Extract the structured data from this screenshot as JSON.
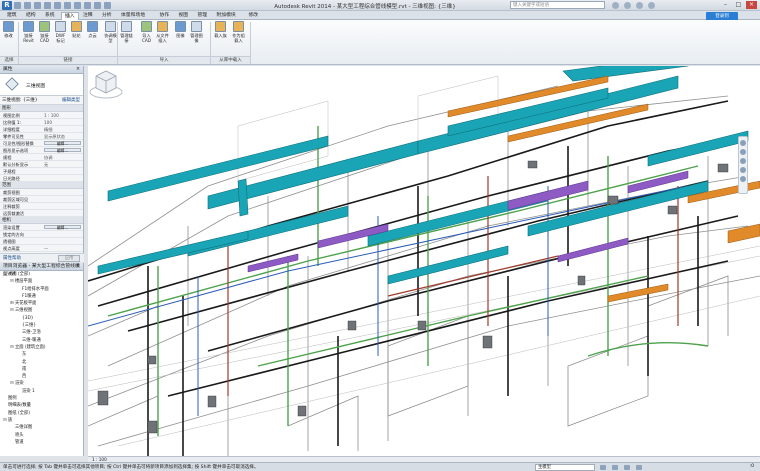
{
  "app": {
    "title": "Autodesk Revit 2014 -  某大型工程综合管线模型.rvt - 三维视图: {三维}",
    "search_placeholder": "键入关键字或短语",
    "signin_label": "登录到",
    "logo_letter": "R"
  },
  "tabs": [
    "建筑",
    "结构",
    "系统",
    "插入",
    "注释",
    "分析",
    "体量和场地",
    "协作",
    "视图",
    "管理",
    "附加模块",
    "修改"
  ],
  "active_tab_index": 3,
  "ribbon": {
    "buttons": [
      {
        "label": "修改",
        "color": "b"
      },
      {
        "label": "链接Revit",
        "color": "b"
      },
      {
        "label": "链接CAD",
        "color": "g"
      },
      {
        "label": "DWF标记",
        "color": ""
      },
      {
        "label": "贴花",
        "color": "o"
      },
      {
        "label": "点云",
        "color": "b"
      },
      {
        "label": "协调模型",
        "color": ""
      },
      {
        "label": "管理链接",
        "color": ""
      },
      {
        "label": "导入CAD",
        "color": "g"
      },
      {
        "label": "从文件插入",
        "color": "o"
      },
      {
        "label": "图像",
        "color": "b"
      },
      {
        "label": "管理图像",
        "color": ""
      },
      {
        "label": "载入族",
        "color": "o"
      },
      {
        "label": "作为组载入",
        "color": "o"
      }
    ],
    "groups": [
      "选择",
      "链接",
      "导入",
      "从库中载入"
    ]
  },
  "properties": {
    "title": "属性",
    "type_name": "三维视图",
    "view_selector": "三维视图: {三维}",
    "edit_type": "编辑类型",
    "section_graphics": "图形",
    "rows": [
      {
        "k": "视图比例",
        "v": "1 : 100"
      },
      {
        "k": "比例值 1:",
        "v": "100"
      },
      {
        "k": "详细程度",
        "v": "精细"
      },
      {
        "k": "零件可见性",
        "v": "显示原状态"
      },
      {
        "k": "可见性/图形替换",
        "v": "编辑...",
        "btn": true
      },
      {
        "k": "图形显示选项",
        "v": "编辑...",
        "btn": true
      },
      {
        "k": "规程",
        "v": "协调"
      },
      {
        "k": "默认分析显示",
        "v": "无"
      },
      {
        "k": "子规程",
        "v": ""
      },
      {
        "k": "日光路径",
        "v": ""
      }
    ],
    "section_extents": "范围",
    "rows2": [
      {
        "k": "裁剪视图",
        "v": ""
      },
      {
        "k": "裁剪区域可见",
        "v": ""
      },
      {
        "k": "注释裁剪",
        "v": ""
      },
      {
        "k": "远剪裁激活",
        "v": ""
      }
    ],
    "section_camera": "相机",
    "rows3": [
      {
        "k": "渲染设置",
        "v": "编辑...",
        "btn": true
      },
      {
        "k": "锁定的方向",
        "v": ""
      },
      {
        "k": "透视图",
        "v": ""
      },
      {
        "k": "视点高度",
        "v": "—"
      },
      {
        "k": "目标高度",
        "v": "—"
      }
    ],
    "help_link": "属性帮助",
    "apply_label": "应用"
  },
  "browser": {
    "title": "项目浏览器 - 某大型工程综合管线模型.rvt",
    "items": [
      {
        "indent": 0,
        "tog": "⊟",
        "label": "视图 (全部)"
      },
      {
        "indent": 1,
        "tog": "⊟",
        "label": "楼层平面"
      },
      {
        "indent": 2,
        "tog": "",
        "label": "F1给排水平面"
      },
      {
        "indent": 2,
        "tog": "",
        "label": "F1暖通"
      },
      {
        "indent": 1,
        "tog": "⊞",
        "label": "天花板平面"
      },
      {
        "indent": 1,
        "tog": "⊟",
        "label": "三维视图"
      },
      {
        "indent": 2,
        "tog": "",
        "label": "{3D}"
      },
      {
        "indent": 2,
        "tog": "",
        "label": "{三维}"
      },
      {
        "indent": 2,
        "tog": "",
        "label": "三维-卫浴"
      },
      {
        "indent": 2,
        "tog": "",
        "label": "三维-暖通"
      },
      {
        "indent": 1,
        "tog": "⊟",
        "label": "立面 (建筑立面)"
      },
      {
        "indent": 2,
        "tog": "",
        "label": "东"
      },
      {
        "indent": 2,
        "tog": "",
        "label": "北"
      },
      {
        "indent": 2,
        "tog": "",
        "label": "南"
      },
      {
        "indent": 2,
        "tog": "",
        "label": "西"
      },
      {
        "indent": 1,
        "tog": "⊟",
        "label": "渲染"
      },
      {
        "indent": 2,
        "tog": "",
        "label": "渲染 1"
      },
      {
        "indent": 0,
        "tog": "",
        "label": "图例"
      },
      {
        "indent": 0,
        "tog": "",
        "label": "明细表/数量"
      },
      {
        "indent": 0,
        "tog": "",
        "label": "图纸 (全部)"
      },
      {
        "indent": 0,
        "tog": "⊟",
        "label": "族"
      },
      {
        "indent": 1,
        "tog": "",
        "label": "三维详图"
      },
      {
        "indent": 1,
        "tog": "",
        "label": "喷头"
      },
      {
        "indent": 1,
        "tog": "",
        "label": "管道"
      }
    ]
  },
  "view_control": {
    "scale": "1 : 100"
  },
  "status": {
    "message": "单击可进行选择; 按 Tab 键并单击可选择其他项目; 按 Ctrl 键并单击可将新项目添加到选择集; 按 Shift 键并单击可取消选择。",
    "model": "主模型",
    "filter": ":0"
  },
  "colors": {
    "duct_teal": "#1aa5b6",
    "duct_purple": "#8e5bc4",
    "pipe_orange": "#e08a2a",
    "pipe_green": "#4ea24c",
    "pipe_black": "#1a1a1a",
    "wall_gray": "#9a9a9a",
    "accent_blue": "#2a7fd4"
  }
}
